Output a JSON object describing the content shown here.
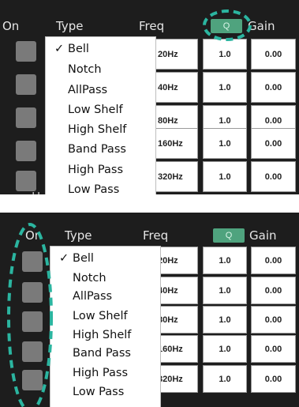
{
  "header": {
    "on": "On",
    "type": "Type",
    "freq": "Freq",
    "q": "Q",
    "gain": "Gain"
  },
  "menu": {
    "checkmark": "✓",
    "options": [
      "Bell",
      "Notch",
      "AllPass",
      "Low Shelf",
      "High Shelf",
      "Band Pass",
      "High Pass",
      "Low Pass"
    ],
    "selected": "Bell"
  },
  "rows": [
    {
      "freq": "20Hz",
      "q": "1.0",
      "gain": "0.00"
    },
    {
      "freq": "40Hz",
      "q": "1.0",
      "gain": "0.00"
    },
    {
      "freq": "80Hz",
      "q": "1.0",
      "gain": "0.00"
    },
    {
      "freq": "160Hz",
      "q": "1.0",
      "gain": "0.00"
    },
    {
      "freq": "320Hz",
      "q": "1.0",
      "gain": "0.00"
    }
  ],
  "partial_label": "H",
  "colors": {
    "background": "#1d1d1d",
    "q_badge": "#4fa37e",
    "highlight_ring": "#2bb5a0",
    "toggle": "#7a7a7a"
  }
}
